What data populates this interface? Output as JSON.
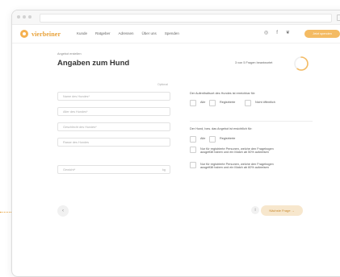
{
  "nav": {
    "brand": "vierbeiner",
    "links": [
      "Kunde",
      "Ratgeber",
      "Adressen",
      "Über uns",
      "Spenden"
    ],
    "cta": "Jetzt spenden",
    "accent": "#F4BB63"
  },
  "page": {
    "breadcrumb": "Angebot erstellen",
    "title": "Angaben zum Hund",
    "progress_text": "3 von 5 Fragen beantwortet",
    "progress": 0.6,
    "optional_hint": "Optional"
  },
  "fields": {
    "name": "Name des Hundes*",
    "age": "Alter des Hundes*",
    "gender": "Geschlecht des Hundes*",
    "breed": "Rasse des Hundes",
    "weight": "Gewicht*",
    "weight_unit": "kg"
  },
  "question1": {
    "label": "Der Aufenthaltsort des Hundes ist erreichbar für:",
    "options": [
      "Alle",
      "Registrierte",
      "Nicht öffentlich"
    ]
  },
  "question2": {
    "label": "Der Hund, bzw. das Angebot ist ersichtlich für:",
    "options": [
      "Alle",
      "Registrierte"
    ],
    "option3_line1": "Nur für registrierte Personen, welche den Fragebogen",
    "option3_line2": "ausgefüllt haben und ein Match ab 50% aufweisen",
    "option4_line1": "Nur für registrierte Personen, welche den Fragebogen",
    "option4_line2": "ausgefüllt haben und ein Match ab 60% aufweisen"
  },
  "actions": {
    "back_icon": "arrow-left-icon",
    "next": "Nächste Frage"
  }
}
